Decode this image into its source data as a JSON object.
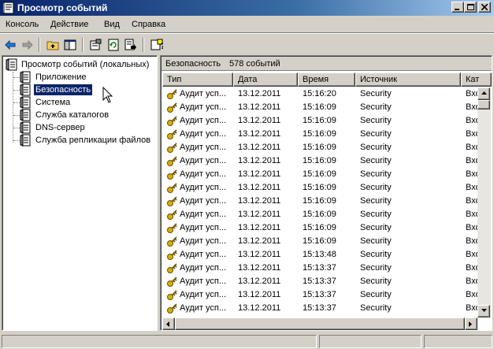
{
  "window": {
    "title": "Просмотр событий"
  },
  "menu": [
    "Консоль",
    "Действие",
    "Вид",
    "Справка"
  ],
  "toolbar": {
    "icons": [
      "back-arrow-icon",
      "forward-arrow-icon",
      "up-folder-icon",
      "show-hide-tree-icon",
      "properties-icon",
      "refresh-icon",
      "export-list-icon",
      "help-icon"
    ]
  },
  "tree": {
    "root": "Просмотр событий (локальных)",
    "items": [
      "Приложение",
      "Безопасность",
      "Система",
      "Служба каталогов",
      "DNS-сервер",
      "Служба репликации файлов"
    ],
    "selected": "Безопасность"
  },
  "details": {
    "header_name": "Безопасность",
    "header_count": "578 событий",
    "columns": [
      "Тип",
      "Дата",
      "Время",
      "Источник",
      "Кат"
    ],
    "rows": [
      {
        "type": "Аудит усп...",
        "date": "13.12.2011",
        "time": "15:16:20",
        "source": "Security",
        "category": "Вхо"
      },
      {
        "type": "Аудит усп...",
        "date": "13.12.2011",
        "time": "15:16:09",
        "source": "Security",
        "category": "Вхо"
      },
      {
        "type": "Аудит усп...",
        "date": "13.12.2011",
        "time": "15:16:09",
        "source": "Security",
        "category": "Вхо"
      },
      {
        "type": "Аудит усп...",
        "date": "13.12.2011",
        "time": "15:16:09",
        "source": "Security",
        "category": "Вхо"
      },
      {
        "type": "Аудит усп...",
        "date": "13.12.2011",
        "time": "15:16:09",
        "source": "Security",
        "category": "Вхо"
      },
      {
        "type": "Аудит усп...",
        "date": "13.12.2011",
        "time": "15:16:09",
        "source": "Security",
        "category": "Вхо"
      },
      {
        "type": "Аудит усп...",
        "date": "13.12.2011",
        "time": "15:16:09",
        "source": "Security",
        "category": "Вхо"
      },
      {
        "type": "Аудит усп...",
        "date": "13.12.2011",
        "time": "15:16:09",
        "source": "Security",
        "category": "Вхо"
      },
      {
        "type": "Аудит усп...",
        "date": "13.12.2011",
        "time": "15:16:09",
        "source": "Security",
        "category": "Вхо"
      },
      {
        "type": "Аудит усп...",
        "date": "13.12.2011",
        "time": "15:16:09",
        "source": "Security",
        "category": "Вхо"
      },
      {
        "type": "Аудит усп...",
        "date": "13.12.2011",
        "time": "15:16:09",
        "source": "Security",
        "category": "Вхо"
      },
      {
        "type": "Аудит усп...",
        "date": "13.12.2011",
        "time": "15:16:09",
        "source": "Security",
        "category": "Вхо"
      },
      {
        "type": "Аудит усп...",
        "date": "13.12.2011",
        "time": "15:13:48",
        "source": "Security",
        "category": "Вхо"
      },
      {
        "type": "Аудит усп...",
        "date": "13.12.2011",
        "time": "15:13:37",
        "source": "Security",
        "category": "Вхо"
      },
      {
        "type": "Аудит усп...",
        "date": "13.12.2011",
        "time": "15:13:37",
        "source": "Security",
        "category": "Вхо"
      },
      {
        "type": "Аудит усп...",
        "date": "13.12.2011",
        "time": "15:13:37",
        "source": "Security",
        "category": "Вхо"
      },
      {
        "type": "Аудит усп...",
        "date": "13.12.2011",
        "time": "15:13:37",
        "source": "Security",
        "category": "Вхо"
      }
    ]
  },
  "colors": {
    "titlebar": "#0a246a",
    "selection": "#0a246a",
    "face": "#d4d0c8",
    "key_icon": "#d8b000"
  }
}
